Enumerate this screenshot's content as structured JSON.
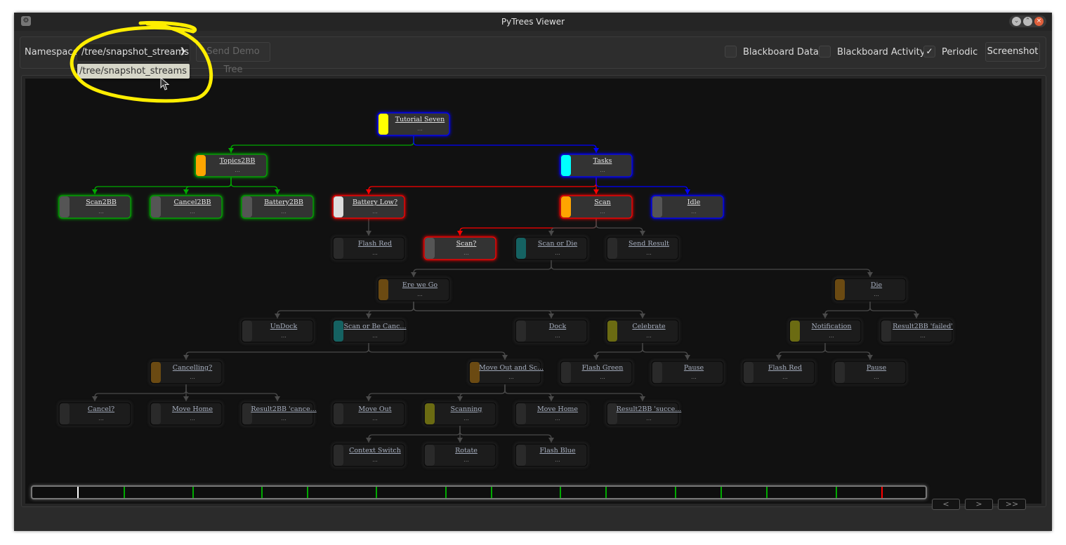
{
  "window": {
    "title": "PyTrees Viewer",
    "app_icon": "pytrees-robot-icon",
    "controls": [
      "minimize",
      "maximize",
      "close"
    ]
  },
  "toolbar": {
    "namespace_label": "Namespace",
    "namespace_value": "/tree/snapshot_streams",
    "namespace_options": [
      "/tree/snapshot_streams"
    ],
    "send_demo_tree_label": "Send Demo Tree",
    "blackboard_data_label": "Blackboard Data",
    "blackboard_data_checked": false,
    "blackboard_activity_label": "Blackboard Activity",
    "blackboard_activity_checked": false,
    "periodic_label": "Periodic",
    "periodic_checked": true,
    "screenshot_label": "Screenshot"
  },
  "colors": {
    "success": "#00aa00",
    "running": "#0000ff",
    "failure": "#ff0000",
    "inactive": "#555555",
    "highlight": "#ffff00"
  },
  "tree": {
    "nodes": [
      {
        "id": "tutorial",
        "name": "Tutorial Seven",
        "detail": "...",
        "block": "#ffff00",
        "status": "running",
        "active": true
      },
      {
        "id": "topics",
        "name": "Topics2BB",
        "detail": "...",
        "block": "#ffa500",
        "status": "success",
        "active": true,
        "parent": "tutorial"
      },
      {
        "id": "tasks",
        "name": "Tasks",
        "detail": "...",
        "block": "#00ffff",
        "status": "running",
        "active": true,
        "parent": "tutorial"
      },
      {
        "id": "scan2bb",
        "name": "Scan2BB",
        "detail": "...",
        "block": "#555555",
        "status": "success",
        "active": true,
        "parent": "topics"
      },
      {
        "id": "cancel2bb",
        "name": "Cancel2BB",
        "detail": "...",
        "block": "#555555",
        "status": "success",
        "active": true,
        "parent": "topics"
      },
      {
        "id": "battery2bb",
        "name": "Battery2BB",
        "detail": "...",
        "block": "#555555",
        "status": "success",
        "active": true,
        "parent": "topics"
      },
      {
        "id": "batterylow",
        "name": "Battery Low?",
        "detail": "...",
        "block": "#dddddd",
        "status": "failure",
        "active": true,
        "parent": "tasks"
      },
      {
        "id": "scan",
        "name": "Scan",
        "detail": "...",
        "block": "#ffa500",
        "status": "failure",
        "active": true,
        "parent": "tasks"
      },
      {
        "id": "idle",
        "name": "Idle",
        "detail": "...",
        "block": "#555555",
        "status": "running",
        "active": true,
        "parent": "tasks"
      },
      {
        "id": "flashred1",
        "name": "Flash Red",
        "detail": "...",
        "block": "#2a2a2a",
        "status": "none",
        "active": false,
        "parent": "batterylow"
      },
      {
        "id": "scanq",
        "name": "Scan?",
        "detail": "...",
        "block": "#555555",
        "status": "failure",
        "active": true,
        "parent": "scan"
      },
      {
        "id": "scanordie",
        "name": "Scan or Die",
        "detail": "...",
        "block": "#156262",
        "status": "none",
        "active": false,
        "parent": "scan"
      },
      {
        "id": "sendresult",
        "name": "Send Result",
        "detail": "...",
        "block": "#2a2a2a",
        "status": "none",
        "active": false,
        "parent": "scan"
      },
      {
        "id": "erewego",
        "name": "Ere we Go",
        "detail": "...",
        "block": "#6b4a12",
        "status": "none",
        "active": false,
        "parent": "scanordie"
      },
      {
        "id": "die",
        "name": "Die",
        "detail": "...",
        "block": "#6b4a12",
        "status": "none",
        "active": false,
        "parent": "scanordie"
      },
      {
        "id": "undock",
        "name": "UnDock",
        "detail": "...",
        "block": "#2a2a2a",
        "status": "none",
        "active": false,
        "parent": "erewego"
      },
      {
        "id": "scanorbe",
        "name": "Scan or Be Canc...",
        "detail": "...",
        "block": "#156262",
        "status": "none",
        "active": false,
        "parent": "erewego"
      },
      {
        "id": "dock",
        "name": "Dock",
        "detail": "...",
        "block": "#2a2a2a",
        "status": "none",
        "active": false,
        "parent": "erewego"
      },
      {
        "id": "celebrate",
        "name": "Celebrate",
        "detail": "...",
        "block": "#6b6b12",
        "status": "none",
        "active": false,
        "parent": "erewego"
      },
      {
        "id": "notification",
        "name": "Notification",
        "detail": "...",
        "block": "#6b6b12",
        "status": "none",
        "active": false,
        "parent": "die"
      },
      {
        "id": "resfailed",
        "name": "Result2BB 'failed'",
        "detail": "...",
        "block": "#2a2a2a",
        "status": "none",
        "active": false,
        "parent": "die"
      },
      {
        "id": "cancelling",
        "name": "Cancelling?",
        "detail": "...",
        "block": "#6b4a12",
        "status": "none",
        "active": false,
        "parent": "scanorbe"
      },
      {
        "id": "moveoutsc",
        "name": "Move Out and Sc...",
        "detail": "...",
        "block": "#6b4a12",
        "status": "none",
        "active": false,
        "parent": "scanorbe"
      },
      {
        "id": "flashgreen",
        "name": "Flash Green",
        "detail": "...",
        "block": "#2a2a2a",
        "status": "none",
        "active": false,
        "parent": "celebrate"
      },
      {
        "id": "pause1",
        "name": "Pause",
        "detail": "...",
        "block": "#2a2a2a",
        "status": "none",
        "active": false,
        "parent": "celebrate"
      },
      {
        "id": "flashred2",
        "name": "Flash Red",
        "detail": "...",
        "block": "#2a2a2a",
        "status": "none",
        "active": false,
        "parent": "notification"
      },
      {
        "id": "pause2",
        "name": "Pause",
        "detail": "...",
        "block": "#2a2a2a",
        "status": "none",
        "active": false,
        "parent": "notification"
      },
      {
        "id": "cancelq",
        "name": "Cancel?",
        "detail": "...",
        "block": "#2a2a2a",
        "status": "none",
        "active": false,
        "parent": "cancelling"
      },
      {
        "id": "movehome1",
        "name": "Move Home",
        "detail": "...",
        "block": "#2a2a2a",
        "status": "none",
        "active": false,
        "parent": "cancelling"
      },
      {
        "id": "rescancel",
        "name": "Result2BB 'cance...",
        "detail": "...",
        "block": "#2a2a2a",
        "status": "none",
        "active": false,
        "parent": "cancelling"
      },
      {
        "id": "moveout",
        "name": "Move Out",
        "detail": "...",
        "block": "#2a2a2a",
        "status": "none",
        "active": false,
        "parent": "moveoutsc"
      },
      {
        "id": "scanning",
        "name": "Scanning",
        "detail": "...",
        "block": "#6b6b12",
        "status": "none",
        "active": false,
        "parent": "moveoutsc"
      },
      {
        "id": "movehome2",
        "name": "Move Home",
        "detail": "...",
        "block": "#2a2a2a",
        "status": "none",
        "active": false,
        "parent": "moveoutsc"
      },
      {
        "id": "ressucc",
        "name": "Result2BB 'succe...",
        "detail": "...",
        "block": "#2a2a2a",
        "status": "none",
        "active": false,
        "parent": "moveoutsc"
      },
      {
        "id": "ctxswitch",
        "name": "Context Switch",
        "detail": "...",
        "block": "#2a2a2a",
        "status": "none",
        "active": false,
        "parent": "scanning"
      },
      {
        "id": "rotate",
        "name": "Rotate",
        "detail": "...",
        "block": "#2a2a2a",
        "status": "none",
        "active": false,
        "parent": "scanning"
      },
      {
        "id": "flashblue",
        "name": "Flash Blue",
        "detail": "...",
        "block": "#2a2a2a",
        "status": "none",
        "active": false,
        "parent": "scanning"
      }
    ]
  },
  "timeline": {
    "marks": [
      "current",
      "event",
      "event",
      "event",
      "event",
      "event",
      "event",
      "event",
      "event",
      "event",
      "event",
      "event",
      "event",
      "event",
      "latest-failure"
    ],
    "buttons": {
      "prev": "<",
      "next": ">",
      "last": ">>"
    }
  }
}
